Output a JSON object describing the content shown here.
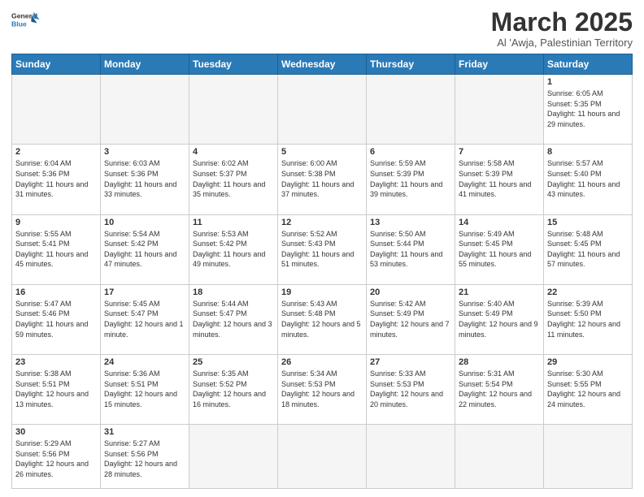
{
  "header": {
    "logo_general": "General",
    "logo_blue": "Blue",
    "month": "March 2025",
    "location": "Al 'Awja, Palestinian Territory"
  },
  "days_of_week": [
    "Sunday",
    "Monday",
    "Tuesday",
    "Wednesday",
    "Thursday",
    "Friday",
    "Saturday"
  ],
  "weeks": [
    [
      {
        "day": "",
        "info": ""
      },
      {
        "day": "",
        "info": ""
      },
      {
        "day": "",
        "info": ""
      },
      {
        "day": "",
        "info": ""
      },
      {
        "day": "",
        "info": ""
      },
      {
        "day": "",
        "info": ""
      },
      {
        "day": "1",
        "info": "Sunrise: 6:05 AM\nSunset: 5:35 PM\nDaylight: 11 hours\nand 29 minutes."
      }
    ],
    [
      {
        "day": "2",
        "info": "Sunrise: 6:04 AM\nSunset: 5:36 PM\nDaylight: 11 hours\nand 31 minutes."
      },
      {
        "day": "3",
        "info": "Sunrise: 6:03 AM\nSunset: 5:36 PM\nDaylight: 11 hours\nand 33 minutes."
      },
      {
        "day": "4",
        "info": "Sunrise: 6:02 AM\nSunset: 5:37 PM\nDaylight: 11 hours\nand 35 minutes."
      },
      {
        "day": "5",
        "info": "Sunrise: 6:00 AM\nSunset: 5:38 PM\nDaylight: 11 hours\nand 37 minutes."
      },
      {
        "day": "6",
        "info": "Sunrise: 5:59 AM\nSunset: 5:39 PM\nDaylight: 11 hours\nand 39 minutes."
      },
      {
        "day": "7",
        "info": "Sunrise: 5:58 AM\nSunset: 5:39 PM\nDaylight: 11 hours\nand 41 minutes."
      },
      {
        "day": "8",
        "info": "Sunrise: 5:57 AM\nSunset: 5:40 PM\nDaylight: 11 hours\nand 43 minutes."
      }
    ],
    [
      {
        "day": "9",
        "info": "Sunrise: 5:55 AM\nSunset: 5:41 PM\nDaylight: 11 hours\nand 45 minutes."
      },
      {
        "day": "10",
        "info": "Sunrise: 5:54 AM\nSunset: 5:42 PM\nDaylight: 11 hours\nand 47 minutes."
      },
      {
        "day": "11",
        "info": "Sunrise: 5:53 AM\nSunset: 5:42 PM\nDaylight: 11 hours\nand 49 minutes."
      },
      {
        "day": "12",
        "info": "Sunrise: 5:52 AM\nSunset: 5:43 PM\nDaylight: 11 hours\nand 51 minutes."
      },
      {
        "day": "13",
        "info": "Sunrise: 5:50 AM\nSunset: 5:44 PM\nDaylight: 11 hours\nand 53 minutes."
      },
      {
        "day": "14",
        "info": "Sunrise: 5:49 AM\nSunset: 5:45 PM\nDaylight: 11 hours\nand 55 minutes."
      },
      {
        "day": "15",
        "info": "Sunrise: 5:48 AM\nSunset: 5:45 PM\nDaylight: 11 hours\nand 57 minutes."
      }
    ],
    [
      {
        "day": "16",
        "info": "Sunrise: 5:47 AM\nSunset: 5:46 PM\nDaylight: 11 hours\nand 59 minutes."
      },
      {
        "day": "17",
        "info": "Sunrise: 5:45 AM\nSunset: 5:47 PM\nDaylight: 12 hours\nand 1 minute."
      },
      {
        "day": "18",
        "info": "Sunrise: 5:44 AM\nSunset: 5:47 PM\nDaylight: 12 hours\nand 3 minutes."
      },
      {
        "day": "19",
        "info": "Sunrise: 5:43 AM\nSunset: 5:48 PM\nDaylight: 12 hours\nand 5 minutes."
      },
      {
        "day": "20",
        "info": "Sunrise: 5:42 AM\nSunset: 5:49 PM\nDaylight: 12 hours\nand 7 minutes."
      },
      {
        "day": "21",
        "info": "Sunrise: 5:40 AM\nSunset: 5:49 PM\nDaylight: 12 hours\nand 9 minutes."
      },
      {
        "day": "22",
        "info": "Sunrise: 5:39 AM\nSunset: 5:50 PM\nDaylight: 12 hours\nand 11 minutes."
      }
    ],
    [
      {
        "day": "23",
        "info": "Sunrise: 5:38 AM\nSunset: 5:51 PM\nDaylight: 12 hours\nand 13 minutes."
      },
      {
        "day": "24",
        "info": "Sunrise: 5:36 AM\nSunset: 5:51 PM\nDaylight: 12 hours\nand 15 minutes."
      },
      {
        "day": "25",
        "info": "Sunrise: 5:35 AM\nSunset: 5:52 PM\nDaylight: 12 hours\nand 16 minutes."
      },
      {
        "day": "26",
        "info": "Sunrise: 5:34 AM\nSunset: 5:53 PM\nDaylight: 12 hours\nand 18 minutes."
      },
      {
        "day": "27",
        "info": "Sunrise: 5:33 AM\nSunset: 5:53 PM\nDaylight: 12 hours\nand 20 minutes."
      },
      {
        "day": "28",
        "info": "Sunrise: 5:31 AM\nSunset: 5:54 PM\nDaylight: 12 hours\nand 22 minutes."
      },
      {
        "day": "29",
        "info": "Sunrise: 5:30 AM\nSunset: 5:55 PM\nDaylight: 12 hours\nand 24 minutes."
      }
    ],
    [
      {
        "day": "30",
        "info": "Sunrise: 5:29 AM\nSunset: 5:56 PM\nDaylight: 12 hours\nand 26 minutes."
      },
      {
        "day": "31",
        "info": "Sunrise: 5:27 AM\nSunset: 5:56 PM\nDaylight: 12 hours\nand 28 minutes."
      },
      {
        "day": "",
        "info": ""
      },
      {
        "day": "",
        "info": ""
      },
      {
        "day": "",
        "info": ""
      },
      {
        "day": "",
        "info": ""
      },
      {
        "day": "",
        "info": ""
      }
    ]
  ]
}
